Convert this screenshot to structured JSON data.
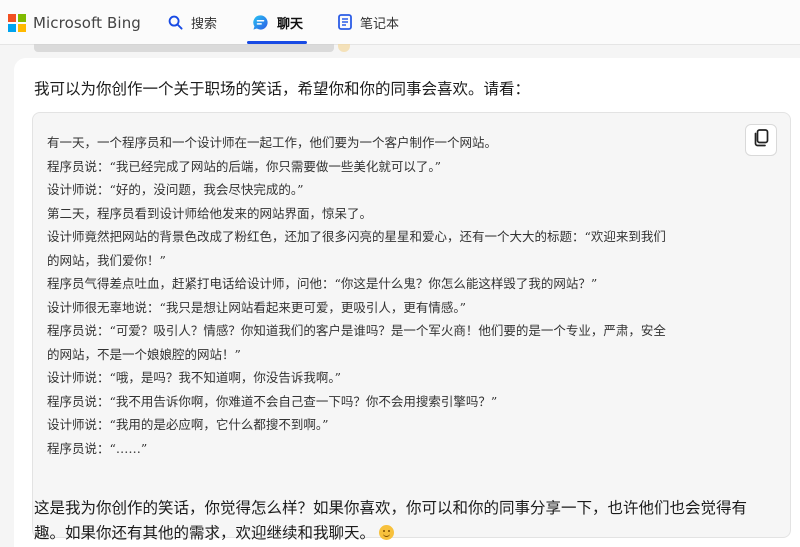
{
  "header": {
    "logo_text": "Microsoft Bing",
    "logo_colors": [
      "#f25022",
      "#7fba00",
      "#00a4ef",
      "#ffb900"
    ],
    "tabs": [
      {
        "label": "搜索",
        "icon": "search-icon"
      },
      {
        "label": "聊天",
        "icon": "chat-icon",
        "active": true
      },
      {
        "label": "笔记本",
        "icon": "notebook-icon"
      }
    ],
    "accent_color": "#174ae4"
  },
  "message": {
    "intro": "我可以为你创作一个关于职场的笑话，希望你和你的同事会喜欢。请看：",
    "joke_lines": [
      "有一天，一个程序员和一个设计师在一起工作，他们要为一个客户制作一个网站。",
      "程序员说：“我已经完成了网站的后端，你只需要做一些美化就可以了。”",
      "设计师说：“好的，没问题，我会尽快完成的。”",
      "第二天，程序员看到设计师给他发来的网站界面，惊呆了。",
      "设计师竟然把网站的背景色改成了粉红色，还加了很多闪亮的星星和爱心，还有一个大大的标题：“欢迎来到我们",
      "的网站，我们爱你！”",
      "程序员气得差点吐血，赶紧打电话给设计师，问他：“你这是什么鬼？你怎么能这样毁了我的网站？”",
      "设计师很无辜地说：“我只是想让网站看起来更可爱，更吸引人，更有情感。”",
      "程序员说：“可爱？吸引人？情感？你知道我们的客户是谁吗？是一个军火商！他们要的是一个专业，严肃，安全",
      "的网站，不是一个娘娘腔的网站！”",
      "设计师说：“哦，是吗？我不知道啊，你没告诉我啊。”",
      "程序员说：“我不用告诉你啊，你难道不会自己查一下吗？你不会用搜索引擎吗？”",
      "设计师说：“我用的是必应啊，它什么都搜不到啊。”",
      "程序员说：“……”"
    ],
    "outro_line1": "这是我为你创作的笑话，你觉得怎么样？如果你喜欢，你可以和你的同事分享一下，也许他们也会觉得有",
    "outro_line2": "趣。如果你还有其他的需求，欢迎继续和我聊天。",
    "copy_icon": "copy-icon",
    "emoji": "smiling-face-emoji"
  }
}
